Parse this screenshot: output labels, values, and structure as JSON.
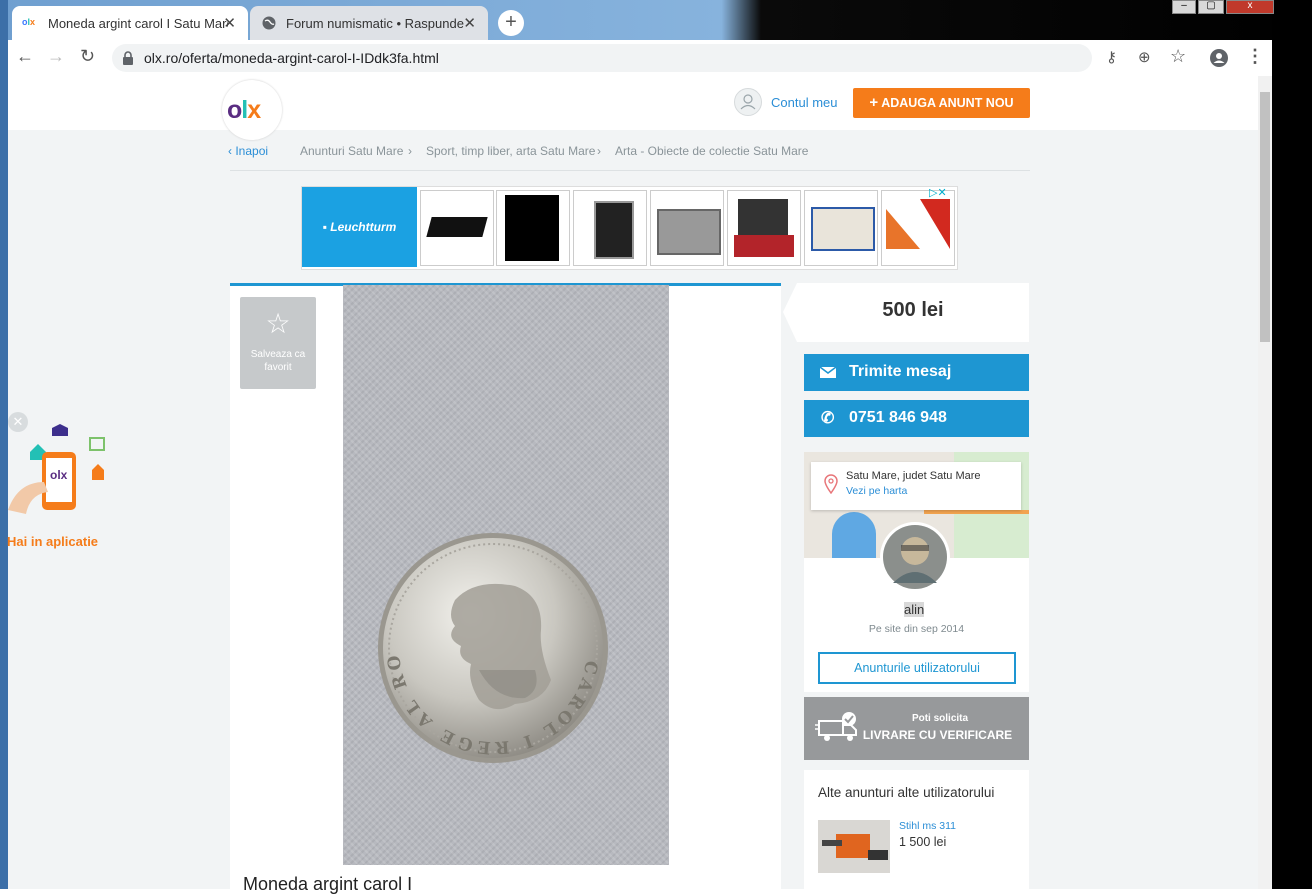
{
  "browser": {
    "tabs": [
      {
        "title": "Moneda argint carol I Satu Mare",
        "favicon": "olx-logo"
      },
      {
        "title": "Forum numismatic • Raspunde",
        "favicon": "globe-icon"
      }
    ],
    "url": "olx.ro/oferta/moneda-argint-carol-I-IDdk3fa.html"
  },
  "header": {
    "logo": "OLX",
    "account_label": "Contul meu",
    "add_button": "ADAUGA ANUNT NOU"
  },
  "breadcrumb": {
    "back": "Inapoi",
    "items": [
      "Anunturi Satu Mare",
      "Sport, timp liber, arta Satu Mare",
      "Arta - Obiecte de colectie Satu Mare"
    ]
  },
  "ad_banner": {
    "brand": "Leuchtturm"
  },
  "listing": {
    "save_label": "Salveaza ca favorit",
    "title": "Moneda argint carol I",
    "coin_inscription": "CAROL I REGE AL ROMANIEI"
  },
  "sidebar": {
    "price": "500 lei",
    "message_button": "Trimite mesaj",
    "phone_button": "0751 846 948",
    "location": "Satu Mare, judet Satu Mare",
    "map_link": "Vezi pe harta",
    "user_name": "alin",
    "member_since": "Pe site din sep 2014",
    "user_ads_button": "Anunturile utilizatorului",
    "delivery_small": "Poti solicita",
    "delivery_big": "LIVRARE CU VERIFICARE",
    "other_ads_title": "Alte anunturi alte utilizatorului",
    "other_ads": [
      {
        "title": "Stihl ms 311",
        "price": "1 500 lei"
      }
    ]
  },
  "app_promo": {
    "label": "Hai in aplicatie"
  },
  "colors": {
    "accent": "#f57c1a",
    "blue": "#1e96d2",
    "olx_teal": "#23e5db"
  }
}
